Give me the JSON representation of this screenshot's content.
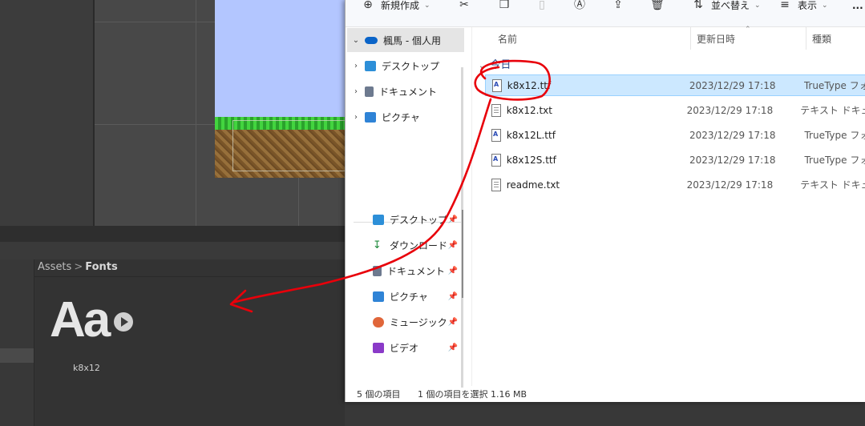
{
  "unity": {
    "breadcrumb": {
      "root": "Assets",
      "separator": ">",
      "current": "Fonts"
    },
    "asset": {
      "preview_text": "Aa",
      "label": "k8x12"
    }
  },
  "explorer": {
    "toolbar": {
      "new_label": "新規作成",
      "sort_label": "並べ替え",
      "view_label": "表示",
      "more_label": "..."
    },
    "sidebar": {
      "account": "楓馬 - 個人用",
      "tree": [
        "デスクトップ",
        "ドキュメント",
        "ピクチャ"
      ],
      "quick_access": [
        "デスクトップ",
        "ダウンロード",
        "ドキュメント",
        "ピクチャ",
        "ミュージック",
        "ビデオ"
      ]
    },
    "columns": {
      "name": "名前",
      "date": "更新日時",
      "type": "種類"
    },
    "group_label": "今日",
    "files": [
      {
        "name": "k8x12.ttf",
        "date": "2023/12/29 17:18",
        "type": "TrueType フォ",
        "kind": "ttf"
      },
      {
        "name": "k8x12.txt",
        "date": "2023/12/29 17:18",
        "type": "テキスト ドキュ",
        "kind": "txt"
      },
      {
        "name": "k8x12L.ttf",
        "date": "2023/12/29 17:18",
        "type": "TrueType フォ",
        "kind": "ttf"
      },
      {
        "name": "k8x12S.ttf",
        "date": "2023/12/29 17:18",
        "type": "TrueType フォ",
        "kind": "ttf"
      },
      {
        "name": "readme.txt",
        "date": "2023/12/29 17:18",
        "type": "テキスト ドキュ",
        "kind": "txt"
      }
    ],
    "status": {
      "count": "5 個の項目",
      "selection": "1 個の項目を選択  1.16 MB"
    }
  },
  "colors": {
    "annotation": "#e8000a",
    "selection": "#cce8ff",
    "onedrive": "#0a64c8"
  }
}
